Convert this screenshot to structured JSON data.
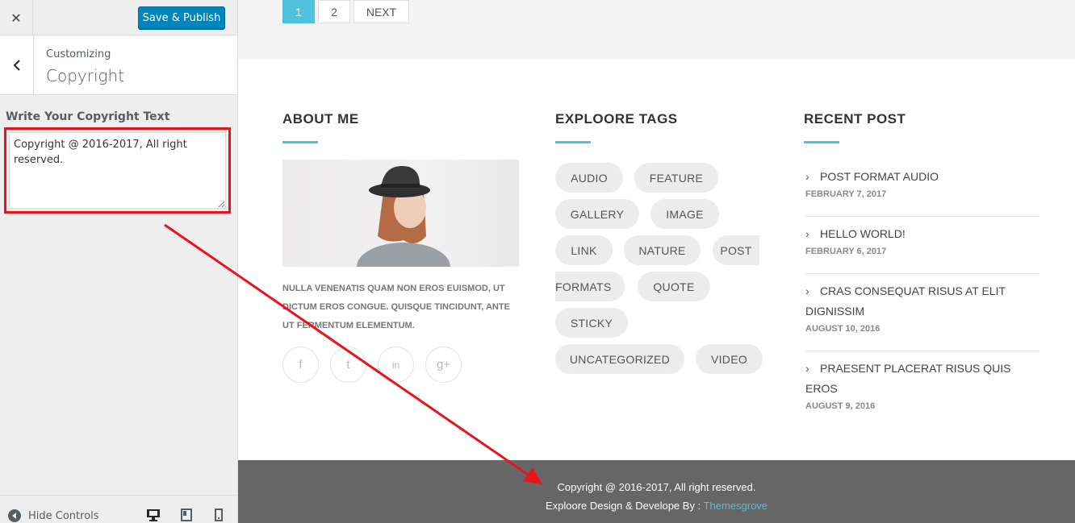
{
  "sidebar": {
    "close_glyph": "✕",
    "publish_label": "Save & Publish",
    "crumb": "Customizing",
    "title": "Copyright",
    "field_label": "Write Your Copyright Text",
    "copyright_value": "Copyright @ 2016-2017, All right reserved.",
    "hide_controls": "Hide Controls"
  },
  "pager": {
    "page1": "1",
    "page2": "2",
    "next": "NEXT"
  },
  "about": {
    "title": "ABOUT ME",
    "text": "NULLA VENENATIS QUAM NON EROS EUISMOD, UT DICTUM EROS CONGUE. QUISQUE TINCIDUNT, ANTE UT FERMENTUM ELEMENTUM.",
    "social": {
      "facebook": "f",
      "twitter": "t",
      "linkedin": "in",
      "google": "g+"
    }
  },
  "tags": {
    "title": "EXPLOORE TAGS",
    "items": [
      "AUDIO",
      "FEATURE",
      "GALLERY",
      "IMAGE",
      "LINK",
      "NATURE",
      "POST",
      "FORMATS",
      "QUOTE",
      "STICKY",
      "UNCATEGORIZED",
      "VIDEO"
    ]
  },
  "recent": {
    "title": "RECENT POST",
    "posts": [
      {
        "title": "POST FORMAT AUDIO",
        "date": "FEBRUARY 7, 2017"
      },
      {
        "title": "HELLO WORLD!",
        "date": "FEBRUARY 6, 2017"
      },
      {
        "title": "CRAS CONSEQUAT RISUS AT ELIT DIGNISSIM",
        "date": "AUGUST 10, 2016"
      },
      {
        "title": "PRAESENT PLACERAT RISUS QUIS EROS",
        "date": "AUGUST 9, 2016"
      }
    ]
  },
  "footer": {
    "copyright": "Copyright @ 2016-2017, All right reserved.",
    "credit_prefix": "Exploore Design & Develope By : ",
    "credit_link": "Themesgrove"
  },
  "colors": {
    "accent": "#4fc1da",
    "publish": "#0085ba",
    "highlight": "#e8141c",
    "footer_bg": "#666666"
  }
}
